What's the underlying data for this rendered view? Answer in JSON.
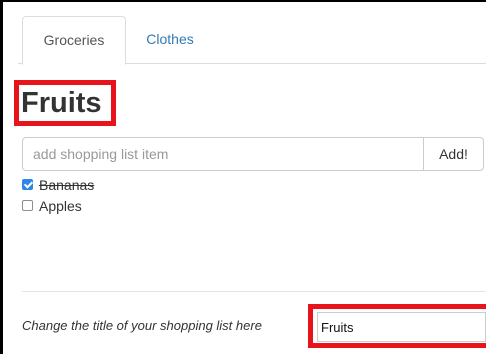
{
  "tabs": [
    {
      "label": "Groceries",
      "active": true
    },
    {
      "label": "Clothes",
      "active": false
    }
  ],
  "list": {
    "title": "Fruits",
    "new_item_placeholder": "add shopping list item",
    "new_item_value": "",
    "add_button_label": "Add!",
    "items": [
      {
        "label": "Bananas",
        "checked": true
      },
      {
        "label": "Apples",
        "checked": false
      }
    ]
  },
  "footer": {
    "change_title_label": "Change the title of your shopping list here",
    "title_value": "Fruits"
  },
  "colors": {
    "highlight": "#e8141c",
    "link": "#337ab7",
    "checkbox_checked": "#2d87e8"
  }
}
